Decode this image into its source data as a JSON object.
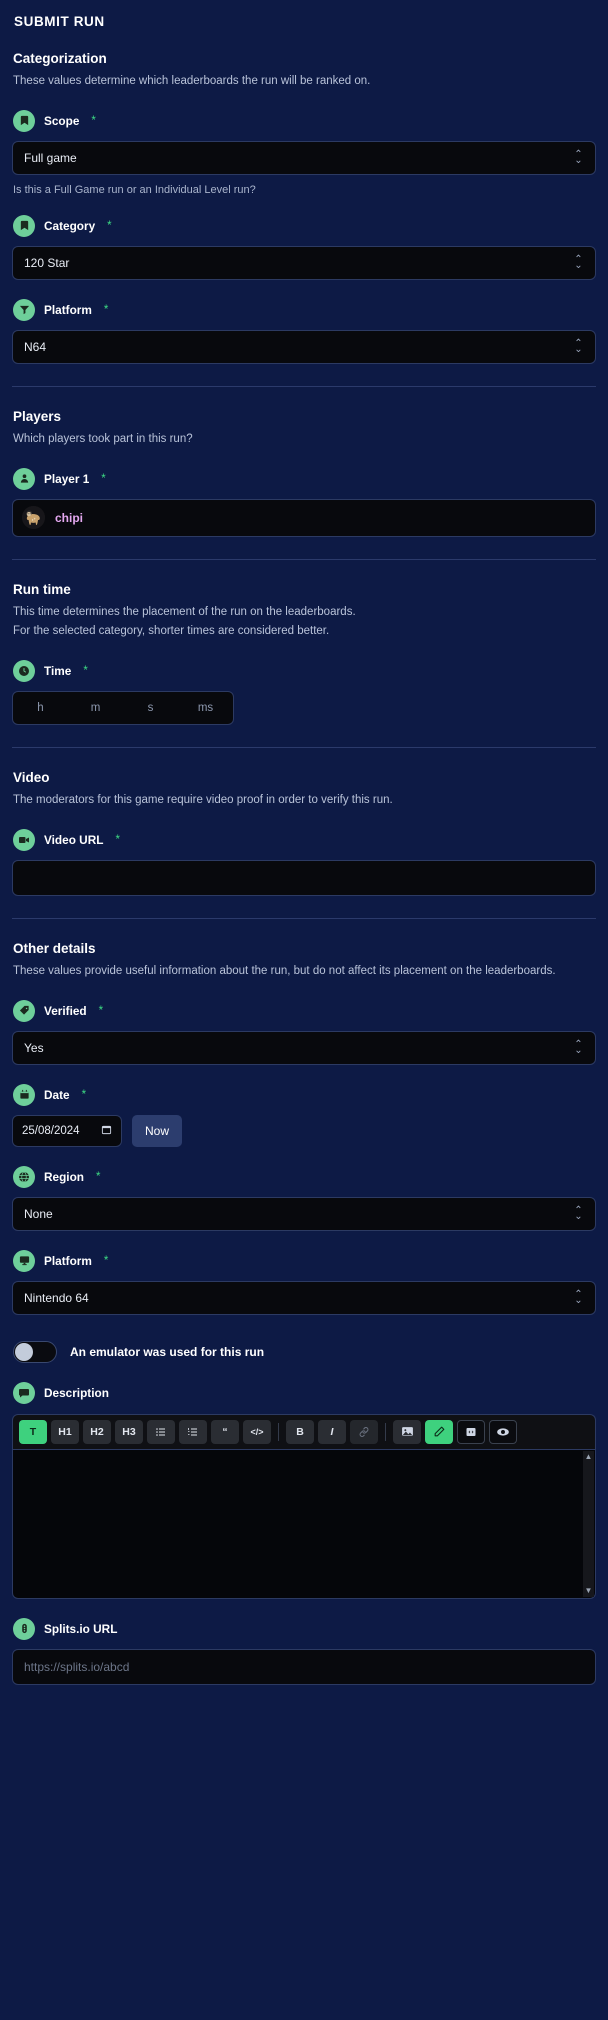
{
  "page": {
    "title": "SUBMIT RUN"
  },
  "sections": {
    "categorization": {
      "title": "Categorization",
      "desc": "These values determine which leaderboards the run will be ranked on.",
      "scope": {
        "label": "Scope",
        "required": "*",
        "value": "Full game",
        "icon": "bookmark-icon",
        "hint": "Is this a Full Game run or an Individual Level run?"
      },
      "category": {
        "label": "Category",
        "required": "*",
        "value": "120 Star",
        "icon": "bookmark-icon"
      },
      "platform": {
        "label": "Platform",
        "required": "*",
        "value": "N64",
        "icon": "funnel-icon"
      }
    },
    "players": {
      "title": "Players",
      "desc": "Which players took part in this run?",
      "player1": {
        "label": "Player 1",
        "required": "*",
        "icon": "user-icon",
        "name": "chipi"
      }
    },
    "runtime": {
      "title": "Run time",
      "desc1": "This time determines the placement of the run on the leaderboards.",
      "desc2": "For the selected category, shorter times are considered better.",
      "time": {
        "label": "Time",
        "required": "*",
        "icon": "clock-icon",
        "units": [
          "h",
          "m",
          "s",
          "ms"
        ]
      }
    },
    "video": {
      "title": "Video",
      "desc": "The moderators for this game require video proof in order to verify this run.",
      "video_url": {
        "label": "Video URL",
        "required": "*",
        "icon": "video-camera-icon",
        "value": ""
      }
    },
    "other": {
      "title": "Other details",
      "desc": "These values provide useful information about the run, but do not affect its placement on the leaderboards.",
      "verified": {
        "label": "Verified",
        "required": "*",
        "value": "Yes",
        "icon": "tag-icon"
      },
      "date": {
        "label": "Date",
        "required": "*",
        "value": "25/08/2024",
        "icon": "calendar-icon",
        "now_label": "Now"
      },
      "region": {
        "label": "Region",
        "required": "*",
        "value": "None",
        "icon": "globe-icon"
      },
      "platform": {
        "label": "Platform",
        "required": "*",
        "value": "Nintendo 64",
        "icon": "monitor-icon"
      },
      "emulator": {
        "label": "An emulator was used for this run",
        "state": "off"
      },
      "description": {
        "label": "Description",
        "icon": "comment-icon",
        "value": ""
      },
      "splits": {
        "label": "Splits.io URL",
        "icon": "splits-icon",
        "value": "",
        "placeholder": "https://splits.io/abcd"
      }
    }
  },
  "editor_toolbar": {
    "buttons": [
      {
        "name": "text-style",
        "label": "T",
        "state": "active"
      },
      {
        "name": "heading-1",
        "label": "H1",
        "state": "normal"
      },
      {
        "name": "heading-2",
        "label": "H2",
        "state": "normal"
      },
      {
        "name": "heading-3",
        "label": "H3",
        "state": "normal"
      },
      {
        "name": "bullet-list",
        "label": "",
        "state": "normal"
      },
      {
        "name": "ordered-list",
        "label": "",
        "state": "normal"
      },
      {
        "name": "blockquote",
        "label": "“",
        "state": "normal"
      },
      {
        "name": "code-block",
        "label": "</>",
        "state": "normal"
      },
      {
        "name": "bold",
        "label": "B",
        "state": "normal"
      },
      {
        "name": "italic",
        "label": "I",
        "state": "normal"
      },
      {
        "name": "link",
        "label": "",
        "state": "dim"
      },
      {
        "name": "image",
        "label": "",
        "state": "normal"
      },
      {
        "name": "edit-mode",
        "label": "",
        "state": "active"
      },
      {
        "name": "source-mode",
        "label": "",
        "state": "dark"
      },
      {
        "name": "preview-mode",
        "label": "",
        "state": "dark"
      }
    ]
  },
  "colors": {
    "background": "#0d1a45",
    "accent_green": "#6ecf9a",
    "required_green": "#3ddc84",
    "input_bg": "#08090d",
    "player_name": "#e4a8f0",
    "toolbar_active": "#3ed17e"
  }
}
